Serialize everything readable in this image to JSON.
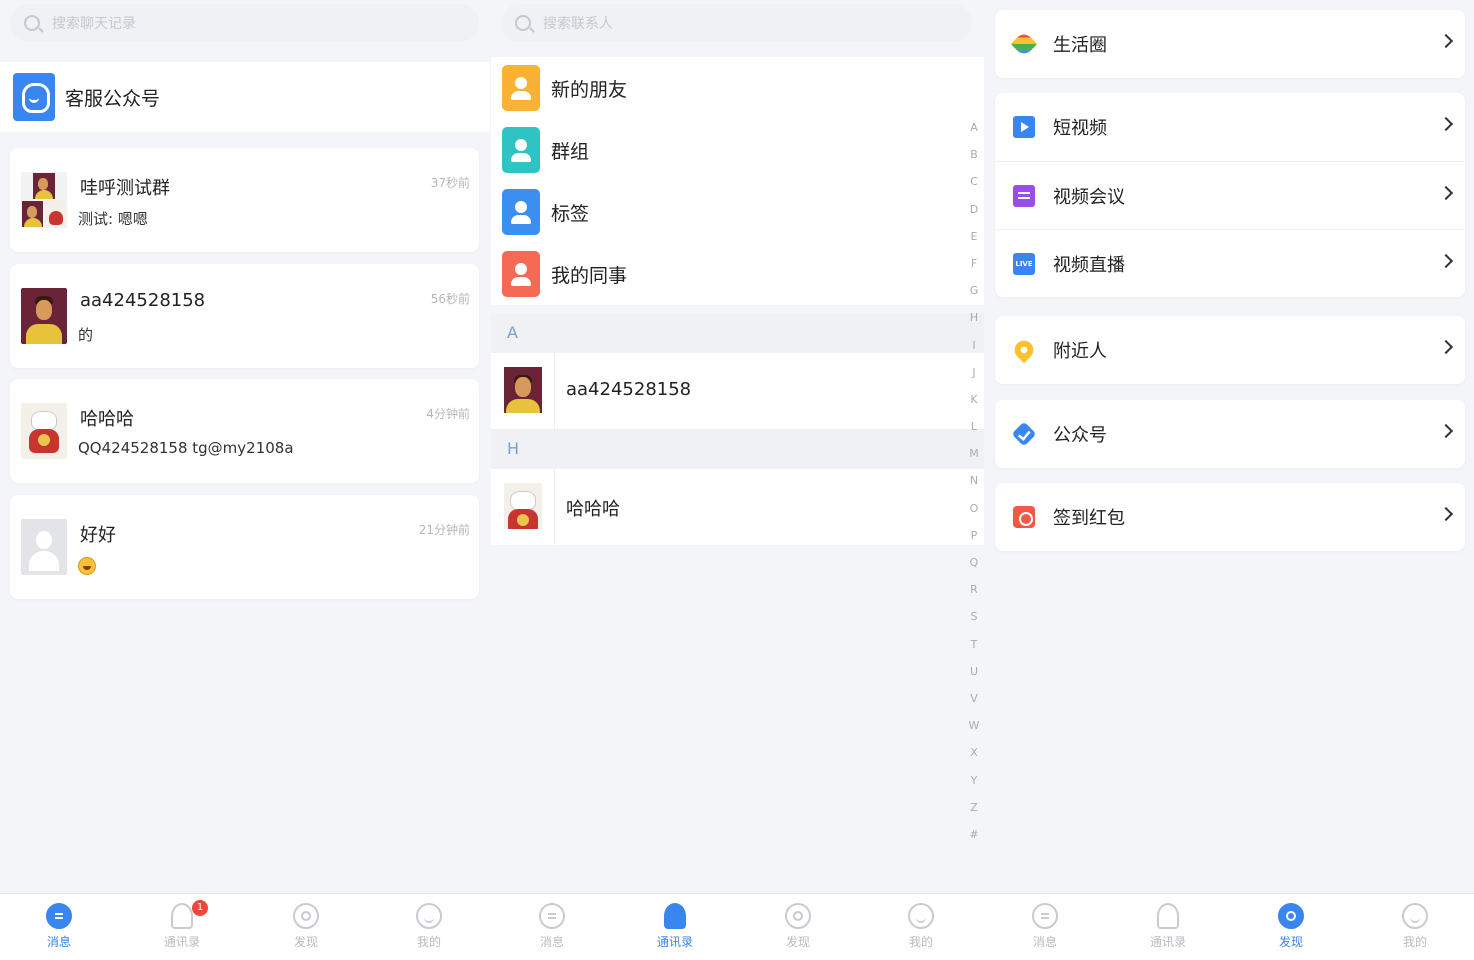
{
  "panel_messages": {
    "search_placeholder": "搜索聊天记录",
    "service_account": "客服公众号",
    "chats": [
      {
        "name": "哇呼测试群",
        "message": "测试: 嗯嗯",
        "time": "37秒前"
      },
      {
        "name": "aa424528158",
        "message": "的",
        "time": "56秒前"
      },
      {
        "name": "哈哈哈",
        "message": "QQ424528158 tg@my2108a",
        "time": "4分钟前"
      },
      {
        "name": "好好",
        "message": "",
        "time": "21分钟前"
      }
    ]
  },
  "panel_contacts": {
    "search_placeholder": "搜索联系人",
    "entries": [
      {
        "label": "新的朋友",
        "color": "#f9b233"
      },
      {
        "label": "群组",
        "color": "#2ec4c4"
      },
      {
        "label": "标签",
        "color": "#3a8ff0"
      },
      {
        "label": "我的同事",
        "color": "#f66a55"
      }
    ],
    "sections": [
      {
        "letter": "A",
        "contact": "aa424528158"
      },
      {
        "letter": "H",
        "contact": "哈哈哈"
      }
    ],
    "alphabet": [
      "A",
      "B",
      "C",
      "D",
      "E",
      "F",
      "G",
      "H",
      "I",
      "J",
      "K",
      "L",
      "M",
      "N",
      "O",
      "P",
      "Q",
      "R",
      "S",
      "T",
      "U",
      "V",
      "W",
      "X",
      "Y",
      "Z",
      "#"
    ]
  },
  "panel_discover": {
    "groups": [
      [
        {
          "label": "生活圈",
          "icon": "pinwheel-icon"
        }
      ],
      [
        {
          "label": "短视频",
          "icon": "play-icon"
        },
        {
          "label": "视频会议",
          "icon": "meeting-icon"
        },
        {
          "label": "视频直播",
          "icon": "live-icon",
          "icon_text": "LIVE"
        }
      ],
      [
        {
          "label": "附近人",
          "icon": "location-pin-icon"
        }
      ],
      [
        {
          "label": "公众号",
          "icon": "verified-icon"
        }
      ],
      [
        {
          "label": "签到红包",
          "icon": "red-envelope-icon"
        }
      ]
    ]
  },
  "tabbar": {
    "tabs": [
      "消息",
      "通讯录",
      "发现",
      "我的",
      "消息",
      "通讯录",
      "发现",
      "我的",
      "消息",
      "通讯录",
      "发现",
      "我的"
    ],
    "badge": "1"
  },
  "colors": {
    "accent": "#3a86f0",
    "badge": "#f0453a"
  }
}
